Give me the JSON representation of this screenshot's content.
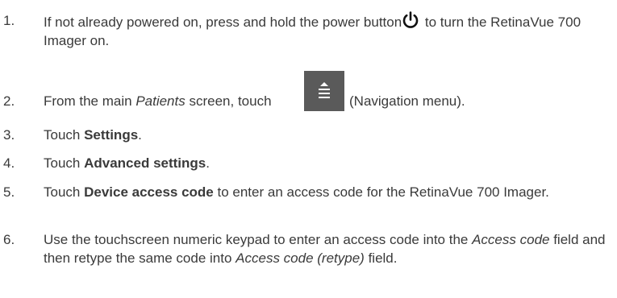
{
  "steps": [
    {
      "num": "1.",
      "a": "If not already powered on, press and hold the power button",
      "b": " to turn the RetinaVue 700 Imager on.",
      "icon": "power-icon"
    },
    {
      "num": "2.",
      "a": "From the main ",
      "a_em": "Patients",
      "b": " screen, touch ",
      "c": " (Navigation menu).",
      "icon": "navigation-menu-icon"
    },
    {
      "num": "3.",
      "a": "Touch ",
      "bold": "Settings",
      "b": "."
    },
    {
      "num": "4.",
      "a": "Touch ",
      "bold": "Advanced settings",
      "b": "."
    },
    {
      "num": "5.",
      "a": "Touch ",
      "bold": "Device access code",
      "b": " to enter an access code for the RetinaVue 700 Imager."
    },
    {
      "num": "6.",
      "a": "Use the touchscreen numeric keypad to enter an access code into the ",
      "em1": "Access code",
      "b": " field and then retype the same code into ",
      "em2": "Access code (retype)",
      "c": " field."
    }
  ]
}
